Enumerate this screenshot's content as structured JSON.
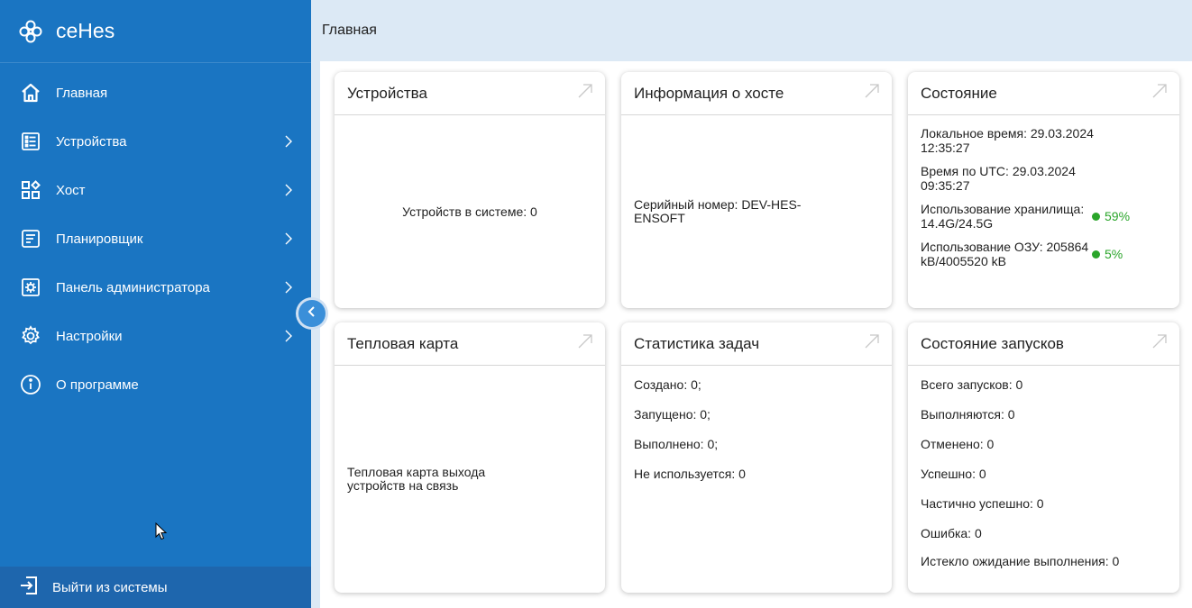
{
  "brand": {
    "title": "ceHes"
  },
  "sidebar": {
    "items": [
      {
        "label": "Главная",
        "icon": "home-icon",
        "has_submenu": false
      },
      {
        "label": "Устройства",
        "icon": "devices-icon",
        "has_submenu": true
      },
      {
        "label": "Хост",
        "icon": "host-icon",
        "has_submenu": true
      },
      {
        "label": "Планировщик",
        "icon": "scheduler-icon",
        "has_submenu": true
      },
      {
        "label": "Панель администратора",
        "icon": "admin-panel-icon",
        "has_submenu": true
      },
      {
        "label": "Настройки",
        "icon": "settings-icon",
        "has_submenu": true
      },
      {
        "label": "О программе",
        "icon": "info-icon",
        "has_submenu": false
      }
    ],
    "logout_label": "Выйти из системы"
  },
  "header": {
    "breadcrumb": "Главная"
  },
  "cards": {
    "devices": {
      "title": "Устройства",
      "text": "Устройств в системе: 0"
    },
    "host_info": {
      "title": "Информация о хосте",
      "text": "Серийный номер: DEV-HES-ENSOFT"
    },
    "status": {
      "title": "Состояние",
      "local_time": "Локальное время: 29.03.2024 12:35:27",
      "utc_time": "Время по UTC: 29.03.2024 09:35:27",
      "storage_label": "Использование хранилища: 14.4G/24.5G",
      "storage_pct": "59%",
      "ram_label": "Использование ОЗУ: 205864 kB/4005520 kB",
      "ram_pct": "5%"
    },
    "heatmap": {
      "title": "Тепловая карта",
      "text": "Тепловая карта выхода устройств на связь"
    },
    "task_stats": {
      "title": "Статистика задач",
      "lines": [
        "Создано: 0;",
        "Запущено: 0;",
        "Выполнено: 0;",
        "Не используется: 0"
      ]
    },
    "launch_status": {
      "title": "Состояние запусков",
      "lines": [
        "Всего запусков: 0",
        "Выполняются: 0",
        "Отменено: 0",
        "Успешно: 0",
        "Частично успешно: 0",
        "Ошибка: 0",
        "Истекло ожидание выполнения: 0"
      ]
    }
  },
  "colors": {
    "sidebar": "#1a75c2",
    "logout_bg": "#1e66ad",
    "main_bg": "#dce9f5",
    "status_green": "#2aa52a"
  }
}
